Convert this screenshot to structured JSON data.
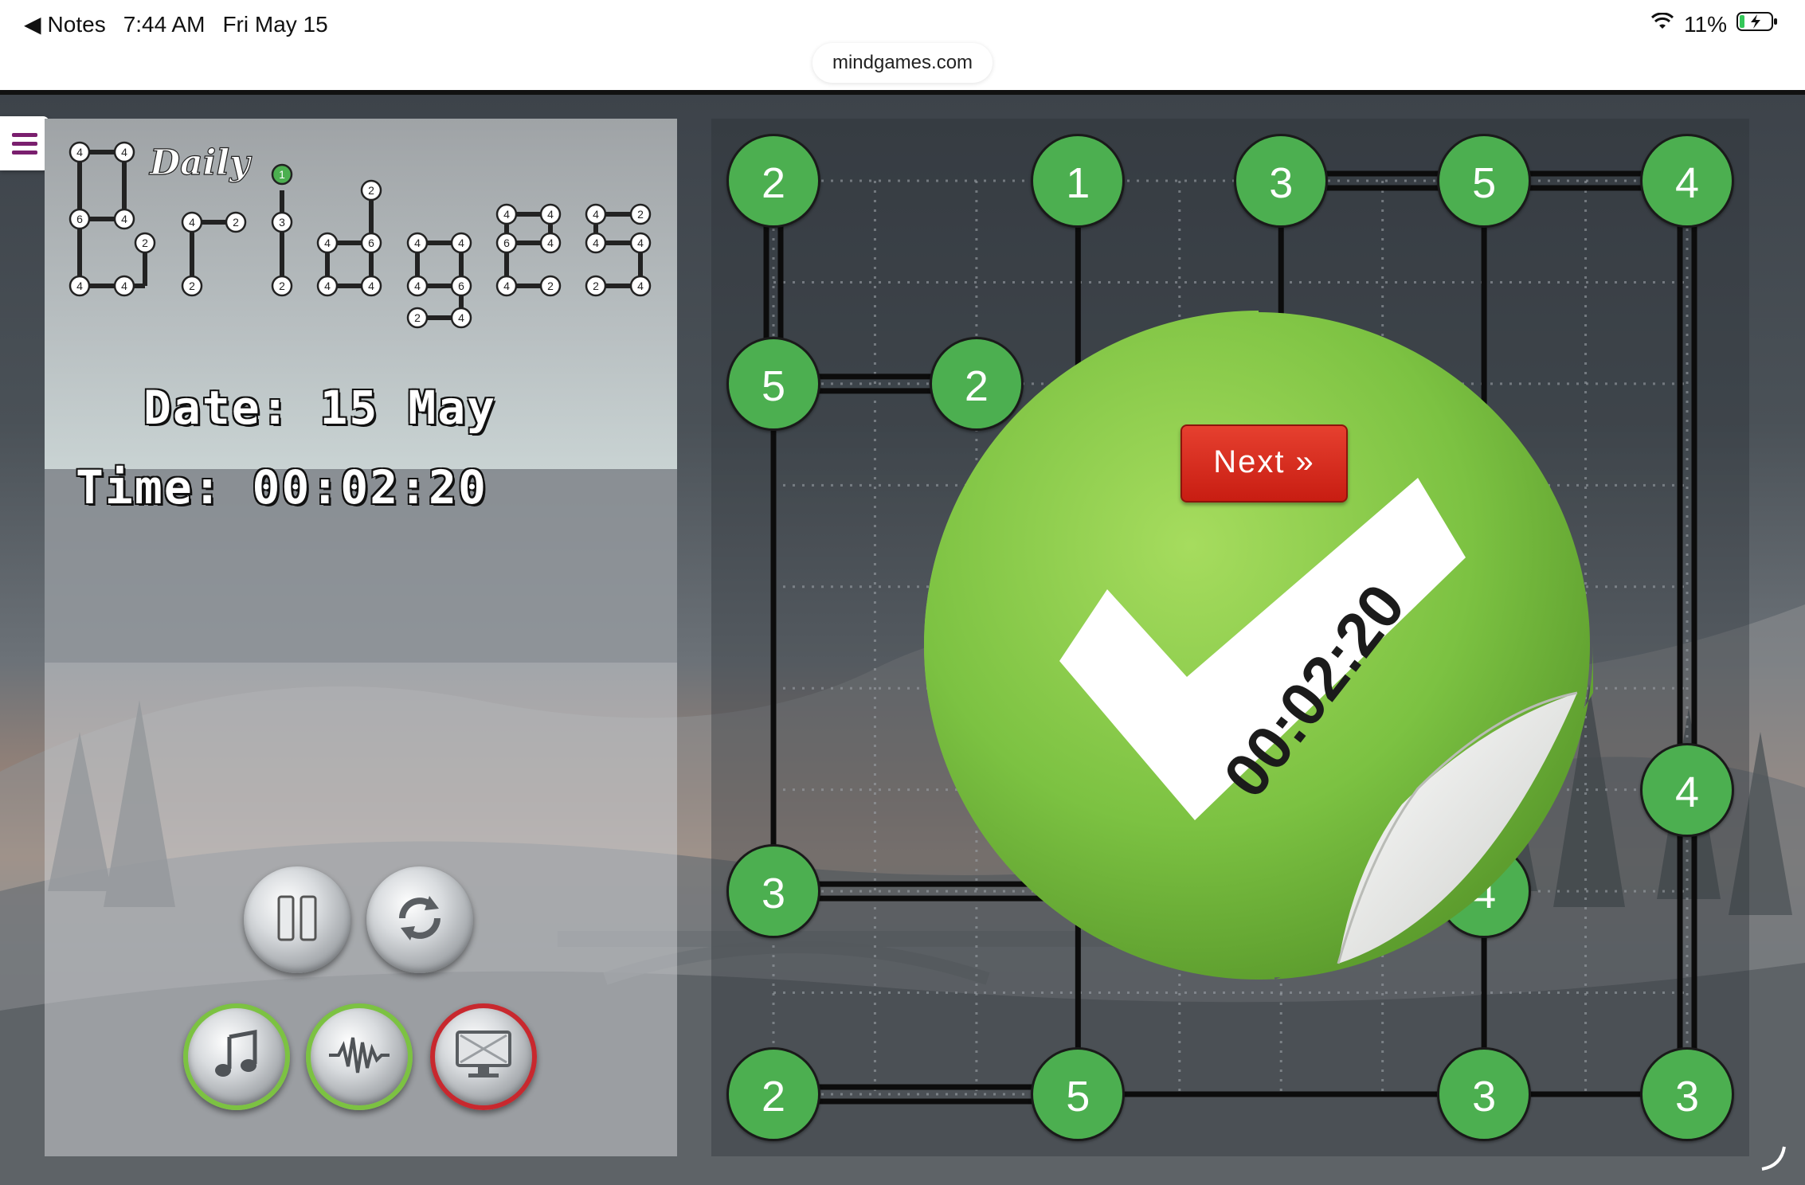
{
  "status_bar": {
    "back_label": "Notes",
    "time": "7:44 AM",
    "date": "Fri May 15",
    "battery": "11%"
  },
  "browser": {
    "url": "mindgames.com"
  },
  "logo": {
    "script_word": "Daily",
    "title_word": "Bridges"
  },
  "info": {
    "date_text": "Date: 15 May",
    "time_text": "Time: 00:02:20"
  },
  "controls": {
    "buttons": [
      "pause-icon",
      "restart-icon",
      "music-icon",
      "sound-icon",
      "fullscreen-icon"
    ]
  },
  "board": {
    "grid_size": 10,
    "islands": [
      {
        "row": 0,
        "col": 0,
        "value": "2"
      },
      {
        "row": 0,
        "col": 3,
        "value": "1"
      },
      {
        "row": 0,
        "col": 5,
        "value": "3"
      },
      {
        "row": 0,
        "col": 7,
        "value": "5"
      },
      {
        "row": 0,
        "col": 9,
        "value": "4"
      },
      {
        "row": 2,
        "col": 0,
        "value": "5"
      },
      {
        "row": 2,
        "col": 2,
        "value": "2"
      },
      {
        "row": 6,
        "col": 9,
        "value": "4"
      },
      {
        "row": 7,
        "col": 0,
        "value": "3"
      },
      {
        "row": 7,
        "col": 7,
        "value": "4"
      },
      {
        "row": 9,
        "col": 0,
        "value": "2"
      },
      {
        "row": 9,
        "col": 3,
        "value": "5"
      },
      {
        "row": 9,
        "col": 7,
        "value": "3"
      },
      {
        "row": 9,
        "col": 9,
        "value": "3"
      }
    ],
    "bridges": [
      {
        "from": [
          0,
          0
        ],
        "to": [
          2,
          0
        ],
        "count": 2
      },
      {
        "from": [
          0,
          3
        ],
        "to": [
          9,
          3
        ],
        "count": 1
      },
      {
        "from": [
          0,
          5
        ],
        "to": [
          0,
          7
        ],
        "count": 2
      },
      {
        "from": [
          0,
          7
        ],
        "to": [
          0,
          9
        ],
        "count": 2
      },
      {
        "from": [
          0,
          5
        ],
        "to": [
          7,
          5
        ],
        "count": 1
      },
      {
        "from": [
          0,
          7
        ],
        "to": [
          7,
          7
        ],
        "count": 1
      },
      {
        "from": [
          0,
          9
        ],
        "to": [
          6,
          9
        ],
        "count": 2
      },
      {
        "from": [
          2,
          0
        ],
        "to": [
          2,
          2
        ],
        "count": 2
      },
      {
        "from": [
          2,
          0
        ],
        "to": [
          7,
          0
        ],
        "count": 1
      },
      {
        "from": [
          6,
          9
        ],
        "to": [
          9,
          9
        ],
        "count": 2
      },
      {
        "from": [
          7,
          0
        ],
        "to": [
          7,
          3
        ],
        "count": 2
      },
      {
        "from": [
          7,
          5
        ],
        "to": [
          7,
          7
        ],
        "count": 2
      },
      {
        "from": [
          7,
          7
        ],
        "to": [
          9,
          7
        ],
        "count": 1
      },
      {
        "from": [
          9,
          0
        ],
        "to": [
          9,
          3
        ],
        "count": 2
      },
      {
        "from": [
          9,
          3
        ],
        "to": [
          9,
          7
        ],
        "count": 1
      },
      {
        "from": [
          9,
          7
        ],
        "to": [
          9,
          9
        ],
        "count": 1
      }
    ]
  },
  "success": {
    "next_label": "Next »",
    "elapsed": "00:02:20"
  },
  "colors": {
    "island": "#4caf50",
    "badge": "#7cc242",
    "next_button": "#d62a1d"
  }
}
